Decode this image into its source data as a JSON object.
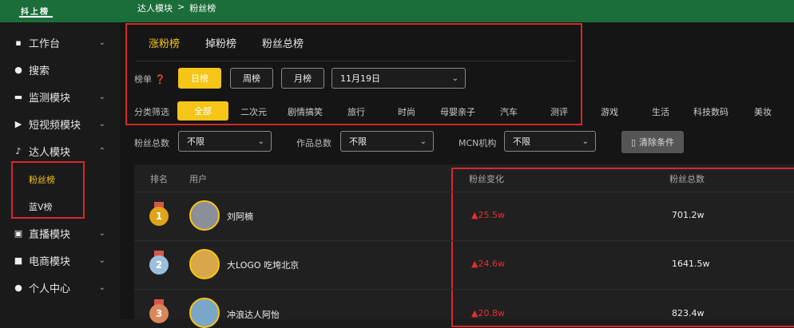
{
  "header": {
    "logo_text": "抖上榜",
    "breadcrumb": [
      "达人模块",
      ">",
      "粉丝榜"
    ]
  },
  "sidebar": {
    "items": [
      {
        "label": "工作台",
        "icon": "grid-icon",
        "has_chevron": true
      },
      {
        "label": "搜索",
        "icon": "search-icon",
        "has_chevron": false
      },
      {
        "label": "监测模块",
        "icon": "monitor-icon",
        "has_chevron": true
      },
      {
        "label": "短视频模块",
        "icon": "video-icon",
        "has_chevron": true
      },
      {
        "label": "达人模块",
        "icon": "tiktok-icon",
        "has_chevron": true,
        "expanded": true
      },
      {
        "label": "直播模块",
        "icon": "tv-icon",
        "has_chevron": true
      },
      {
        "label": "电商模块",
        "icon": "shop-icon",
        "has_chevron": true
      },
      {
        "label": "个人中心",
        "icon": "user-icon",
        "has_chevron": true
      }
    ],
    "sub_items": [
      {
        "label": "粉丝榜",
        "active": true
      },
      {
        "label": "蓝V榜",
        "active": false
      }
    ]
  },
  "tabs": [
    {
      "label": "涨粉榜",
      "active": true
    },
    {
      "label": "掉粉榜",
      "active": false
    },
    {
      "label": "粉丝总榜",
      "active": false
    }
  ],
  "ranking": {
    "label": "榜单",
    "buttons": [
      "日榜",
      "周榜",
      "月榜"
    ],
    "active_index": 0,
    "date_value": "11月19日"
  },
  "category": {
    "label": "分类筛选",
    "items": [
      "全部",
      "二次元",
      "剧情搞笑",
      "旅行",
      "时尚",
      "母婴亲子",
      "汽车",
      "测评",
      "游戏",
      "生活",
      "科技数码",
      "美妆"
    ]
  },
  "filters": {
    "fans_total": {
      "label": "粉丝总数",
      "value": "不限"
    },
    "works_total": {
      "label": "作品总数",
      "value": "不限"
    },
    "mcn": {
      "label": "MCN机构",
      "value": "不限"
    },
    "clear_label": "清除条件"
  },
  "table": {
    "headers": {
      "rank": "排名",
      "user": "用户",
      "change": "粉丝变化",
      "total": "粉丝总数"
    },
    "rows": [
      {
        "rank": "1",
        "name": "刘阿楠",
        "change": "25.5w",
        "total": "701.2w",
        "medal_color": "#e0a419"
      },
      {
        "rank": "2",
        "name": "大LOGO 吃垮北京",
        "change": "24.6w",
        "total": "1641.5w",
        "medal_color": "#9dbedc"
      },
      {
        "rank": "3",
        "name": "冲浪达人阿怡",
        "change": "20.8w",
        "total": "823.4w",
        "medal_color": "#d9875a"
      }
    ]
  },
  "colors": {
    "accent": "#f5c518",
    "header_green": "#1b6e3a",
    "highlight_red": "#d62828",
    "delta_red": "#e03030"
  }
}
